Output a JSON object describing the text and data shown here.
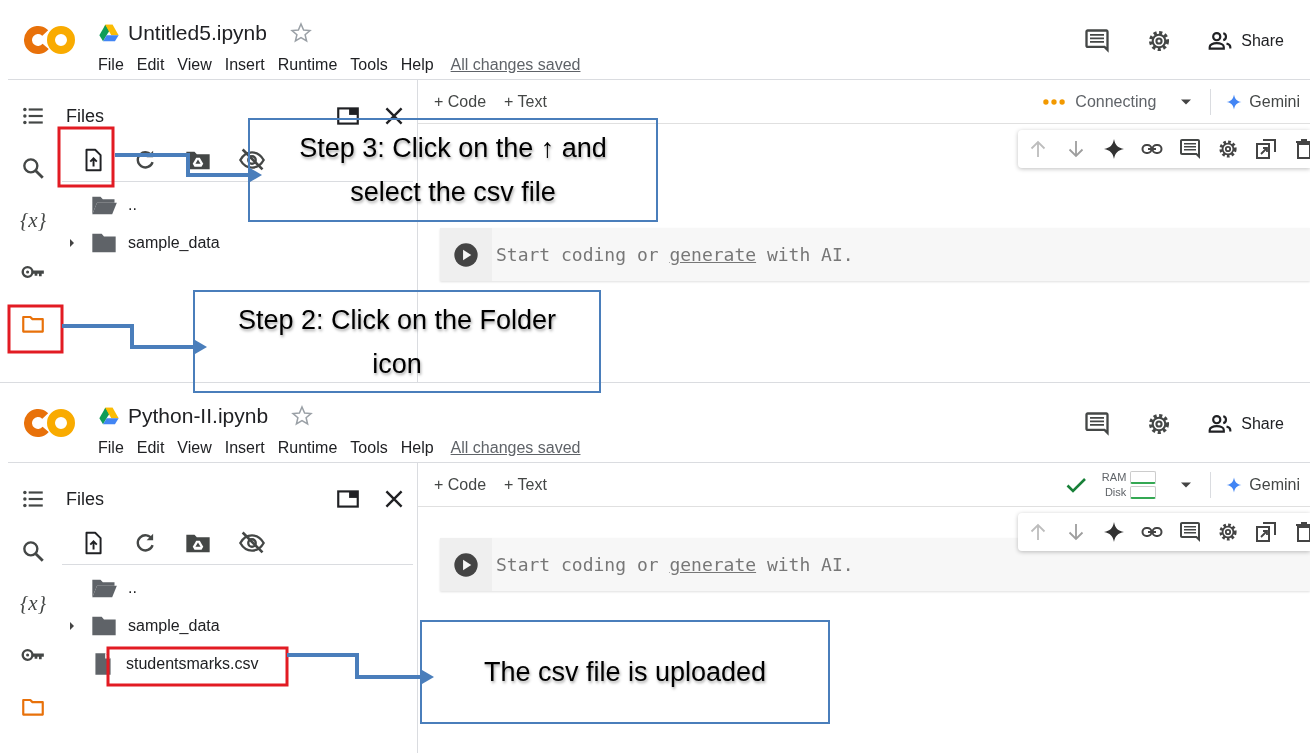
{
  "screens": [
    {
      "title": "Untitled5.ipynb",
      "starred": false,
      "menu": [
        "File",
        "Edit",
        "View",
        "Insert",
        "Runtime",
        "Tools",
        "Help"
      ],
      "save_status": "All changes saved",
      "share": "Share",
      "add_buttons": [
        "+ Code",
        "+ Text"
      ],
      "runtime": {
        "kind": "connecting",
        "label": "Connecting"
      },
      "gemini": "Gemini",
      "sidebar": [
        {
          "kind": "toc",
          "selected": false
        },
        {
          "kind": "search",
          "selected": false
        },
        {
          "kind": "variables",
          "label": "{x}",
          "selected": false
        },
        {
          "kind": "secrets",
          "selected": false
        },
        {
          "kind": "files",
          "selected": true
        }
      ],
      "files_panel": {
        "title": "Files",
        "entries": [
          {
            "kind": "parent",
            "name": ".."
          },
          {
            "kind": "folder",
            "name": "sample_data",
            "expanded": false
          }
        ]
      },
      "cell": {
        "placeholder_start": "Start coding or",
        "placeholder_link": "generate",
        "placeholder_end": "with AI."
      }
    },
    {
      "title": "Python-II.ipynb",
      "starred": false,
      "menu": [
        "File",
        "Edit",
        "View",
        "Insert",
        "Runtime",
        "Tools",
        "Help"
      ],
      "save_status": "All changes saved",
      "share": "Share",
      "add_buttons": [
        "+ Code",
        "+ Text"
      ],
      "runtime": {
        "kind": "resources",
        "ram_label": "RAM",
        "disk_label": "Disk"
      },
      "gemini": "Gemini",
      "sidebar": [
        {
          "kind": "toc",
          "selected": false
        },
        {
          "kind": "search",
          "selected": false
        },
        {
          "kind": "variables",
          "label": "{x}",
          "selected": false
        },
        {
          "kind": "secrets",
          "selected": false
        },
        {
          "kind": "files",
          "selected": true
        }
      ],
      "files_panel": {
        "title": "Files",
        "entries": [
          {
            "kind": "parent",
            "name": ".."
          },
          {
            "kind": "folder",
            "name": "sample_data",
            "expanded": false
          },
          {
            "kind": "file",
            "name": "studentsmarks.csv"
          }
        ]
      },
      "cell": {
        "placeholder_start": "Start coding or",
        "placeholder_link": "generate",
        "placeholder_end": "with AI."
      }
    }
  ],
  "callouts": [
    {
      "text": "Step 3: Click on the ↑ and select the csv file"
    },
    {
      "text": "Step 2: Click on the Folder icon"
    },
    {
      "text": "The csv file is uploaded"
    }
  ]
}
